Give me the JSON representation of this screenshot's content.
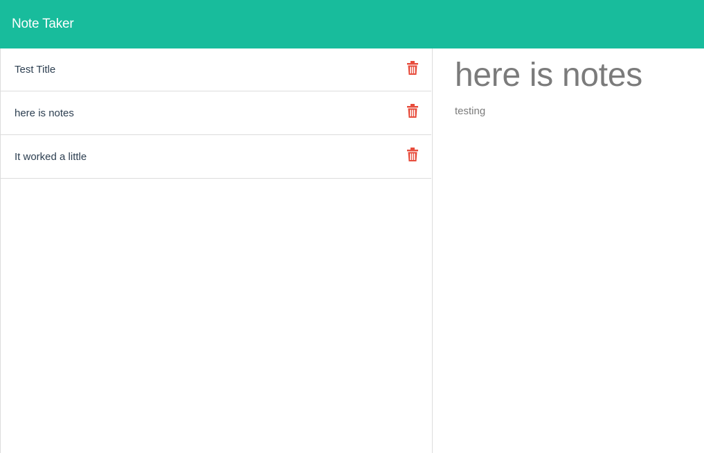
{
  "app": {
    "title": "Note Taker",
    "accent_color": "#18bc9c",
    "delete_icon_color": "#e74c3c"
  },
  "notes": [
    {
      "title": "Test Title",
      "icon": "trash-icon"
    },
    {
      "title": "here is notes",
      "icon": "trash-icon"
    },
    {
      "title": "It worked a little",
      "icon": "trash-icon"
    }
  ],
  "active_note": {
    "title": "here is notes",
    "text": "testing"
  }
}
